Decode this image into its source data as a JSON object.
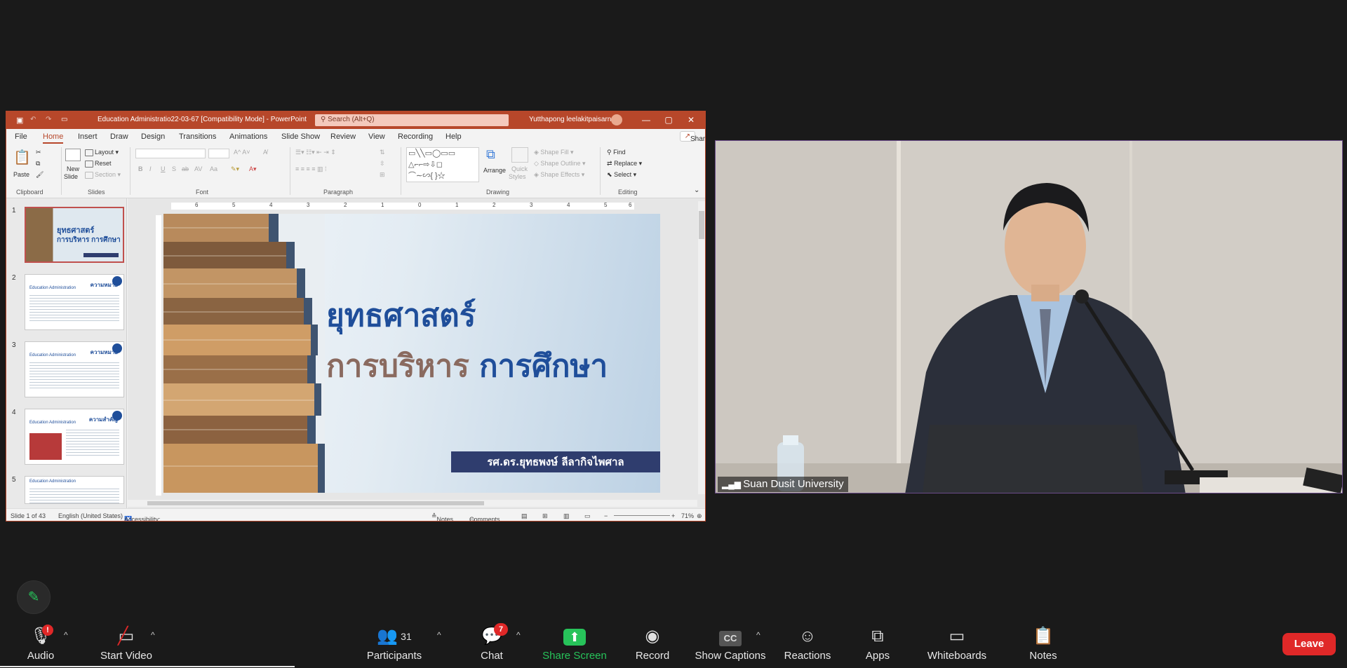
{
  "ppt": {
    "title": "Education Administratio22-03-67 [Compatibility Mode] - PowerPoint",
    "search_placeholder": "Search (Alt+Q)",
    "user": "Yutthapong leelakitpaisarn",
    "menu": [
      "File",
      "Home",
      "Insert",
      "Draw",
      "Design",
      "Transitions",
      "Animations",
      "Slide Show",
      "Review",
      "View",
      "Recording",
      "Help"
    ],
    "share": "Share",
    "ribbon": {
      "paste": "Paste",
      "clipboard": "Clipboard",
      "new_slide": "New",
      "new_slide2": "Slide",
      "layout": "Layout",
      "reset": "Reset",
      "section": "Section",
      "slides": "Slides",
      "font": "Font",
      "paragraph": "Paragraph",
      "arrange": "Arrange",
      "quick_styles": "Quick",
      "quick_styles2": "Styles",
      "shape_fill": "Shape Fill",
      "shape_outline": "Shape Outline",
      "shape_effects": "Shape Effects",
      "drawing": "Drawing",
      "find": "Find",
      "replace": "Replace",
      "select": "Select",
      "editing": "Editing"
    },
    "thumbs": [
      {
        "num": "1",
        "title": "ยุทธศาสตร์",
        "sub": "การบริหาร การศึกษา"
      },
      {
        "num": "2",
        "title": "ความหมาย",
        "sub": "Education Administration"
      },
      {
        "num": "3",
        "title": "ความหมาย",
        "sub": "Education Administration"
      },
      {
        "num": "4",
        "title": "ความสำคัญ",
        "sub": "Education Administration"
      },
      {
        "num": "5",
        "title": "",
        "sub": "Education Administration"
      }
    ],
    "ruler": [
      "6",
      "5",
      "4",
      "3",
      "2",
      "1",
      "0",
      "1",
      "2",
      "3",
      "4",
      "5",
      "6"
    ],
    "slide": {
      "title1": "ยุทธศาสตร์",
      "title2a": "การบริหาร",
      "title2b": "การศึกษา",
      "author": "รศ.ดร.ยุทธพงษ์ ลีลากิจไพศาล"
    },
    "status": {
      "slide": "Slide 1 of 43",
      "lang": "English (United States)",
      "accessibility": "Accessibility: Unavailable",
      "notes": "Notes",
      "comments": "Comments",
      "zoom": "71%"
    }
  },
  "video": {
    "participant": "Suan Dusit University"
  },
  "toolbar": {
    "audio": "Audio",
    "audio_badge": "!",
    "video": "Start Video",
    "participants": "Participants",
    "participants_count": "31",
    "chat": "Chat",
    "chat_badge": "7",
    "share": "Share Screen",
    "record": "Record",
    "captions": "Show Captions",
    "captions_icon": "CC",
    "reactions": "Reactions",
    "apps": "Apps",
    "whiteboards": "Whiteboards",
    "notes": "Notes",
    "leave": "Leave"
  },
  "colors": {
    "ppt_accent": "#b7472a",
    "share_green": "#27c35a",
    "leave_red": "#e02828"
  }
}
